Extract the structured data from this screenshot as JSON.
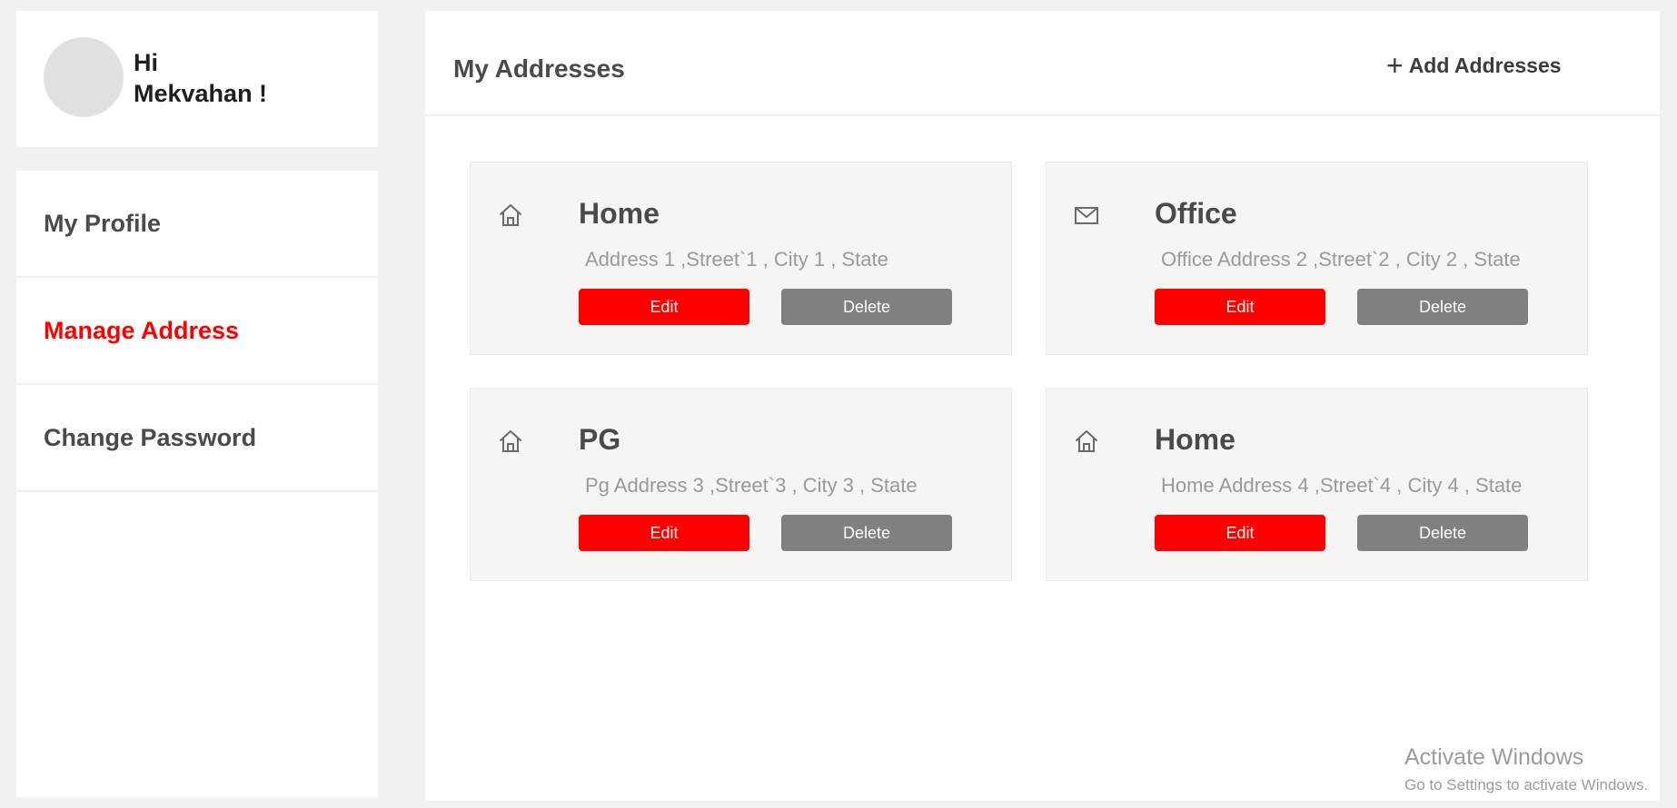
{
  "user": {
    "greeting": "Hi",
    "name": "Mekvahan !"
  },
  "sidebar": {
    "items": [
      {
        "label": "My Profile"
      },
      {
        "label": "Manage Address"
      },
      {
        "label": "Change Password"
      }
    ],
    "active_label": "Manage Address",
    "active_color": "#ff0000"
  },
  "main": {
    "title": "My Addresses",
    "add_label": "Add Addresses",
    "add_icon": "plus-icon"
  },
  "addresses": [
    {
      "icon": "home-icon",
      "title": "Home",
      "line": "Address 1 ,Street`1 , City 1 , State",
      "edit_label": "Edit",
      "delete_label": "Delete"
    },
    {
      "icon": "mail-icon",
      "title": "Office",
      "line": "Office Address 2 ,Street`2 , City 2 , State",
      "edit_label": "Edit",
      "delete_label": "Delete"
    },
    {
      "icon": "home-icon",
      "title": "PG",
      "line": "Pg Address 3 ,Street`3 , City 3 , State",
      "edit_label": "Edit",
      "delete_label": "Delete"
    },
    {
      "icon": "home-icon",
      "title": "Home",
      "line": "Home Address 4 ,Street`4 , City 4 , State",
      "edit_label": "Edit",
      "delete_label": "Delete"
    }
  ],
  "colors": {
    "edit_button": "#ff0000",
    "delete_button": "#808080"
  },
  "watermark": {
    "line1": "Activate Windows",
    "line2": "Go to Settings to activate Windows."
  }
}
